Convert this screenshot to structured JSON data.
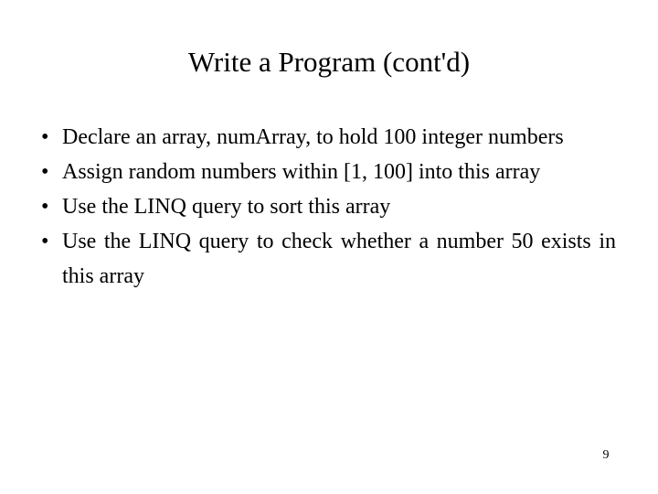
{
  "slide": {
    "title": "Write a Program (cont'd)",
    "bullet_marker": "•",
    "bullets": [
      {
        "text": "Declare an array, numArray, to hold 100 integer numbers",
        "wraps": true
      },
      {
        "text": "Assign random numbers within [1, 100] into this array",
        "wraps": true
      },
      {
        "text": "Use the LINQ query to sort this array",
        "wraps": false
      },
      {
        "text": "Use the LINQ query to check whether a number 50 exists in this array",
        "wraps": true
      }
    ],
    "page_number": "9",
    "colors": {
      "background": "#ffffff",
      "text": "#000000"
    }
  }
}
